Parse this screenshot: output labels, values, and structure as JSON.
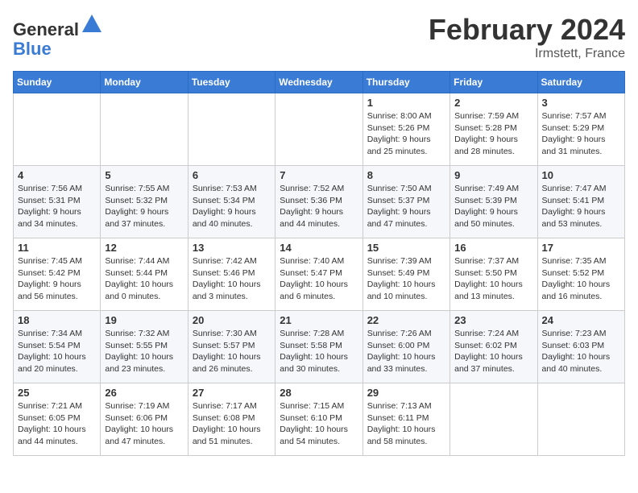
{
  "header": {
    "logo_line1": "General",
    "logo_line2": "Blue",
    "month_title": "February 2024",
    "location": "Irmstett, France"
  },
  "columns": [
    "Sunday",
    "Monday",
    "Tuesday",
    "Wednesday",
    "Thursday",
    "Friday",
    "Saturday"
  ],
  "weeks": [
    [
      {
        "day": "",
        "info": ""
      },
      {
        "day": "",
        "info": ""
      },
      {
        "day": "",
        "info": ""
      },
      {
        "day": "",
        "info": ""
      },
      {
        "day": "1",
        "info": "Sunrise: 8:00 AM\nSunset: 5:26 PM\nDaylight: 9 hours\nand 25 minutes."
      },
      {
        "day": "2",
        "info": "Sunrise: 7:59 AM\nSunset: 5:28 PM\nDaylight: 9 hours\nand 28 minutes."
      },
      {
        "day": "3",
        "info": "Sunrise: 7:57 AM\nSunset: 5:29 PM\nDaylight: 9 hours\nand 31 minutes."
      }
    ],
    [
      {
        "day": "4",
        "info": "Sunrise: 7:56 AM\nSunset: 5:31 PM\nDaylight: 9 hours\nand 34 minutes."
      },
      {
        "day": "5",
        "info": "Sunrise: 7:55 AM\nSunset: 5:32 PM\nDaylight: 9 hours\nand 37 minutes."
      },
      {
        "day": "6",
        "info": "Sunrise: 7:53 AM\nSunset: 5:34 PM\nDaylight: 9 hours\nand 40 minutes."
      },
      {
        "day": "7",
        "info": "Sunrise: 7:52 AM\nSunset: 5:36 PM\nDaylight: 9 hours\nand 44 minutes."
      },
      {
        "day": "8",
        "info": "Sunrise: 7:50 AM\nSunset: 5:37 PM\nDaylight: 9 hours\nand 47 minutes."
      },
      {
        "day": "9",
        "info": "Sunrise: 7:49 AM\nSunset: 5:39 PM\nDaylight: 9 hours\nand 50 minutes."
      },
      {
        "day": "10",
        "info": "Sunrise: 7:47 AM\nSunset: 5:41 PM\nDaylight: 9 hours\nand 53 minutes."
      }
    ],
    [
      {
        "day": "11",
        "info": "Sunrise: 7:45 AM\nSunset: 5:42 PM\nDaylight: 9 hours\nand 56 minutes."
      },
      {
        "day": "12",
        "info": "Sunrise: 7:44 AM\nSunset: 5:44 PM\nDaylight: 10 hours\nand 0 minutes."
      },
      {
        "day": "13",
        "info": "Sunrise: 7:42 AM\nSunset: 5:46 PM\nDaylight: 10 hours\nand 3 minutes."
      },
      {
        "day": "14",
        "info": "Sunrise: 7:40 AM\nSunset: 5:47 PM\nDaylight: 10 hours\nand 6 minutes."
      },
      {
        "day": "15",
        "info": "Sunrise: 7:39 AM\nSunset: 5:49 PM\nDaylight: 10 hours\nand 10 minutes."
      },
      {
        "day": "16",
        "info": "Sunrise: 7:37 AM\nSunset: 5:50 PM\nDaylight: 10 hours\nand 13 minutes."
      },
      {
        "day": "17",
        "info": "Sunrise: 7:35 AM\nSunset: 5:52 PM\nDaylight: 10 hours\nand 16 minutes."
      }
    ],
    [
      {
        "day": "18",
        "info": "Sunrise: 7:34 AM\nSunset: 5:54 PM\nDaylight: 10 hours\nand 20 minutes."
      },
      {
        "day": "19",
        "info": "Sunrise: 7:32 AM\nSunset: 5:55 PM\nDaylight: 10 hours\nand 23 minutes."
      },
      {
        "day": "20",
        "info": "Sunrise: 7:30 AM\nSunset: 5:57 PM\nDaylight: 10 hours\nand 26 minutes."
      },
      {
        "day": "21",
        "info": "Sunrise: 7:28 AM\nSunset: 5:58 PM\nDaylight: 10 hours\nand 30 minutes."
      },
      {
        "day": "22",
        "info": "Sunrise: 7:26 AM\nSunset: 6:00 PM\nDaylight: 10 hours\nand 33 minutes."
      },
      {
        "day": "23",
        "info": "Sunrise: 7:24 AM\nSunset: 6:02 PM\nDaylight: 10 hours\nand 37 minutes."
      },
      {
        "day": "24",
        "info": "Sunrise: 7:23 AM\nSunset: 6:03 PM\nDaylight: 10 hours\nand 40 minutes."
      }
    ],
    [
      {
        "day": "25",
        "info": "Sunrise: 7:21 AM\nSunset: 6:05 PM\nDaylight: 10 hours\nand 44 minutes."
      },
      {
        "day": "26",
        "info": "Sunrise: 7:19 AM\nSunset: 6:06 PM\nDaylight: 10 hours\nand 47 minutes."
      },
      {
        "day": "27",
        "info": "Sunrise: 7:17 AM\nSunset: 6:08 PM\nDaylight: 10 hours\nand 51 minutes."
      },
      {
        "day": "28",
        "info": "Sunrise: 7:15 AM\nSunset: 6:10 PM\nDaylight: 10 hours\nand 54 minutes."
      },
      {
        "day": "29",
        "info": "Sunrise: 7:13 AM\nSunset: 6:11 PM\nDaylight: 10 hours\nand 58 minutes."
      },
      {
        "day": "",
        "info": ""
      },
      {
        "day": "",
        "info": ""
      }
    ]
  ]
}
